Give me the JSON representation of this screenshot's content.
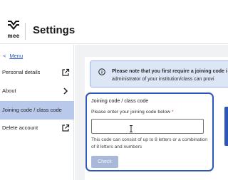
{
  "header": {
    "logo_text": "mee",
    "title": "Settings"
  },
  "sidebar": {
    "back_label": "Menu",
    "items": [
      {
        "label": "Personal details",
        "icon": "external-link-icon"
      },
      {
        "label": "About",
        "icon": "chevron-right-icon"
      },
      {
        "label": "Joining code / class code",
        "active": true
      },
      {
        "label": "Delete account",
        "icon": "external-link-icon"
      }
    ]
  },
  "notice": {
    "text_bold": "Please note that you first require a joining code i",
    "text_rest": "administrator of your institution/class can provi"
  },
  "join_panel": {
    "title": "Joining code / class code",
    "field_label": "Please enter your joining code below",
    "required_marker": "*",
    "input_value": "",
    "help_text": "This code can consist of up to 8 letters or a combination of 8 letters and numbers",
    "check_label": "Check"
  },
  "colors": {
    "accent": "#2c57b8",
    "active_nav": "#b9c9ec",
    "notice_bg": "#dde6f7",
    "link": "#2a57c9"
  }
}
